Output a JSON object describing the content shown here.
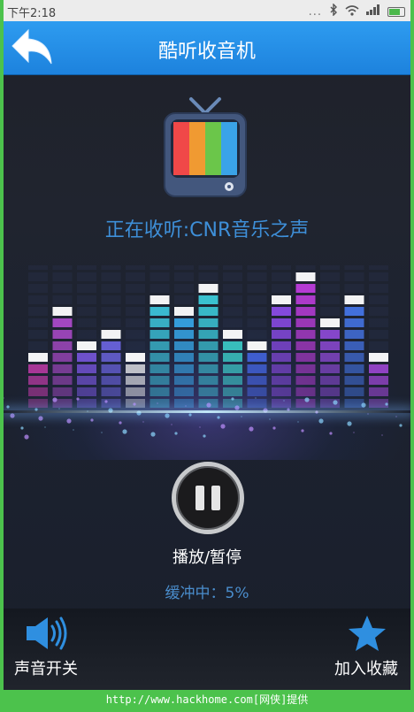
{
  "status_bar": {
    "time": "下午2:18",
    "dots": "...",
    "battery_icon": "battery-icon"
  },
  "header": {
    "title": "酷听收音机",
    "back_icon": "back-arrow-icon",
    "color": "#1f88e0"
  },
  "now_playing": {
    "text": "正在收听:CNR音乐之声"
  },
  "equalizer": {
    "bars": [
      {
        "level": 5,
        "color": "#e040c0"
      },
      {
        "level": 9,
        "color": "#c050e0"
      },
      {
        "level": 6,
        "color": "#8a60ff"
      },
      {
        "level": 7,
        "color": "#7a70ff"
      },
      {
        "level": 5,
        "color": "#ffffff"
      },
      {
        "level": 10,
        "color": "#40d8f0"
      },
      {
        "level": 9,
        "color": "#3ab8ff"
      },
      {
        "level": 11,
        "color": "#40e0f0"
      },
      {
        "level": 7,
        "color": "#40e8e0"
      },
      {
        "level": 6,
        "color": "#4a70ff"
      },
      {
        "level": 10,
        "color": "#9a50ff"
      },
      {
        "level": 12,
        "color": "#d040f0"
      },
      {
        "level": 8,
        "color": "#a050f0"
      },
      {
        "level": 10,
        "color": "#4a80ff"
      },
      {
        "level": 5,
        "color": "#c050ff"
      }
    ]
  },
  "player": {
    "play_pause_label": "播放/暂停",
    "buffer_text": "缓冲中：5%"
  },
  "bottom_bar": {
    "sound_label": "声音开关",
    "favorite_label": "加入收藏",
    "accent": "#2f8fe0"
  },
  "watermark": {
    "text": "http://www.hackhome.com[网侠]提供"
  }
}
